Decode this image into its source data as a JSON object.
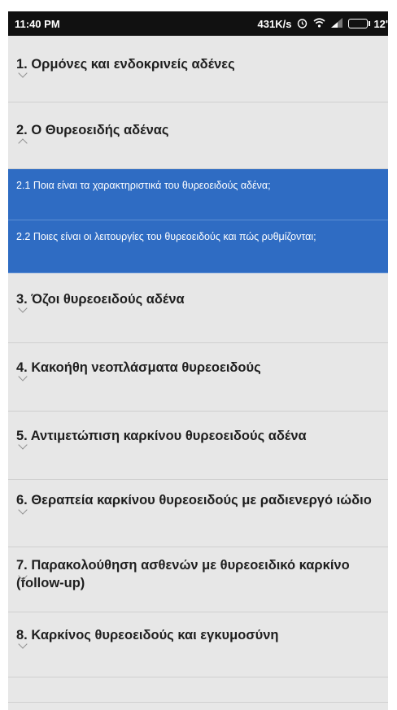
{
  "status_bar": {
    "time": "11:40 PM",
    "network_speed": "431K/s",
    "battery_level": "12'",
    "icons": [
      "alarm-icon",
      "wifi-icon",
      "signal-icon",
      "battery-icon"
    ]
  },
  "list": {
    "chapters": [
      {
        "label": "1. Ορμόνες και ενδοκρινείς αδένες",
        "expanded": false
      },
      {
        "label": "2. Ο Θυρεοειδής αδένας",
        "expanded": true
      },
      {
        "label": "3. Όζοι θυρεοειδούς αδένα",
        "expanded": false
      },
      {
        "label": "4. Κακοήθη νεοπλάσματα θυρεοειδούς",
        "expanded": false
      },
      {
        "label": "5. Αντιμετώπιση καρκίνου θυρεοειδούς αδένα",
        "expanded": false
      },
      {
        "label": "6. Θεραπεία καρκίνου θυρεοειδούς με ραδιενεργό ιώδιο",
        "expanded": false
      },
      {
        "label": "7. Παρακολούθηση ασθενών με θυρεοειδικό καρκίνο (follow-up)",
        "expanded": false
      },
      {
        "label": "8. Καρκίνος θυρεοειδούς και εγκυμοσύνη",
        "expanded": false
      }
    ],
    "subitems": [
      {
        "label": "2.1 Ποια είναι τα χαρακτηριστικά του θυρεοειδούς αδένα;"
      },
      {
        "label": "2.2 Ποιες είναι οι λειτουργίες του θυρεοειδούς και πώς ρυθμίζονται;"
      }
    ]
  },
  "colors": {
    "status_bar": "#111111",
    "list_background": "#e7e7e7",
    "selected_background": "#2f6cc3",
    "chapter_text": "#1e1e1e",
    "chevron": "#8f8f8f"
  }
}
